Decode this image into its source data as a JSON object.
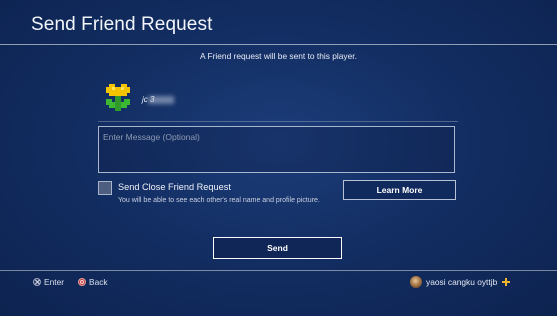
{
  "header": {
    "title": "Send Friend Request"
  },
  "notice": "A Friend request will be sent to this player.",
  "player": {
    "username": "jc     3",
    "avatar_icon": "pixel-flower-icon"
  },
  "message": {
    "placeholder": "Enter Message (Optional)",
    "value": ""
  },
  "close_friend": {
    "label": "Send Close Friend Request",
    "description": "You will be able to see each other's real name and profile picture.",
    "checked": false
  },
  "buttons": {
    "learn_more": "Learn More",
    "send": "Send"
  },
  "footer": {
    "enter_label": "Enter",
    "back_label": "Back",
    "user_name": "yaosi cangku oyttjb"
  },
  "colors": {
    "background": "#132e63",
    "plus_badge": "#f0b42a",
    "back_circle": "#c23b3b"
  }
}
